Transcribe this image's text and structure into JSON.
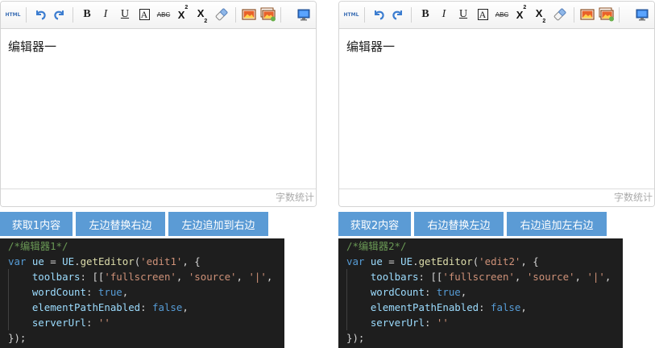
{
  "editors": [
    {
      "id": "left",
      "content": "编辑器一",
      "wordcount_label": "字数统计",
      "buttons": [
        "获取1内容",
        "左边替换右边",
        "左边追加到右边"
      ],
      "code": {
        "comment": "/*编辑器1*/",
        "line2": {
          "kw": "var",
          "var": "ue",
          "eq": " = ",
          "obj": "UE",
          "dot": ".",
          "fn": "getEditor",
          "open": "(",
          "str": "'edit1'",
          "rest": ", {"
        },
        "line3": {
          "prop": "toolbars",
          "colon": ": [[",
          "s1": "'fullscreen'",
          "c1": ", ",
          "s2": "'source'",
          "c2": ", ",
          "s3": "'|'",
          "c3": ","
        },
        "line4": {
          "prop": "wordCount",
          "colon": ": ",
          "lit": "true",
          "end": ","
        },
        "line5": {
          "prop": "elementPathEnabled",
          "colon": ": ",
          "lit": "false",
          "end": ","
        },
        "line6": {
          "prop": "serverUrl",
          "colon": ": ",
          "str": "''"
        },
        "line7": "});"
      }
    },
    {
      "id": "right",
      "content": "编辑器一",
      "wordcount_label": "字数统计",
      "buttons": [
        "获取2内容",
        "右边替换左边",
        "右边追加左右边"
      ],
      "code": {
        "comment": "/*编辑器2*/",
        "line2": {
          "kw": "var",
          "var": "ue",
          "eq": " = ",
          "obj": "UE",
          "dot": ".",
          "fn": "getEditor",
          "open": "(",
          "str": "'edit2'",
          "rest": ", {"
        },
        "line3": {
          "prop": "toolbars",
          "colon": ": [[",
          "s1": "'fullscreen'",
          "c1": ", ",
          "s2": "'source'",
          "c2": ", ",
          "s3": "'|'",
          "c3": ","
        },
        "line4": {
          "prop": "wordCount",
          "colon": ": ",
          "lit": "true",
          "end": ","
        },
        "line5": {
          "prop": "elementPathEnabled",
          "colon": ": ",
          "lit": "false",
          "end": ","
        },
        "line6": {
          "prop": "serverUrl",
          "colon": ": ",
          "str": "''"
        },
        "line7": "});"
      }
    }
  ],
  "toolbar": {
    "source_label": "HTML",
    "bold": "B",
    "italic": "I",
    "underline": "U",
    "fontborder": "A",
    "strikethrough": "ABC",
    "superscript_base": "X",
    "superscript_mark": "2",
    "subscript_base": "X",
    "subscript_mark": "2",
    "icons": [
      "undo-icon",
      "redo-icon",
      "eraser-icon",
      "insert-image-icon",
      "multi-image-icon",
      "fullscreen-icon"
    ]
  },
  "colors": {
    "accent": "#5b9bd5",
    "code_bg": "#1e1e1e",
    "icon_blue": "#3c7dd0"
  }
}
